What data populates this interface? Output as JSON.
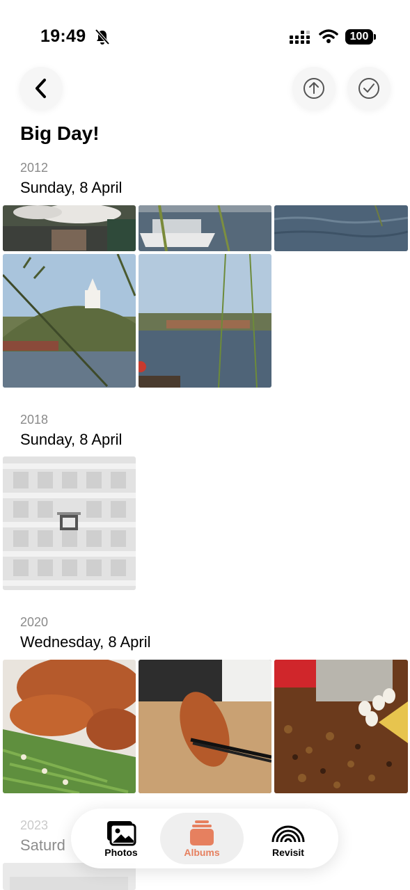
{
  "status": {
    "time": "19:49",
    "battery": "100",
    "icons": [
      "bell-slash-icon",
      "signal-icon",
      "wifi-icon",
      "battery-icon"
    ]
  },
  "nav": {
    "back_icon": "chevron-left-icon",
    "share_icon": "arrow-up-circle-icon",
    "select_icon": "checkmark-circle-icon"
  },
  "album": {
    "title": "Big Day!"
  },
  "sections": [
    {
      "year": "2012",
      "date": "Sunday, 8 April"
    },
    {
      "year": "2018",
      "date": "Sunday, 8 April"
    },
    {
      "year": "2020",
      "date": "Wednesday, 8 April"
    },
    {
      "year": "2023",
      "date": "Saturd"
    }
  ],
  "tabbar": {
    "photos": "Photos",
    "albums": "Albums",
    "revisit": "Revisit",
    "active": "Albums",
    "accent_color": "#e6805f"
  }
}
